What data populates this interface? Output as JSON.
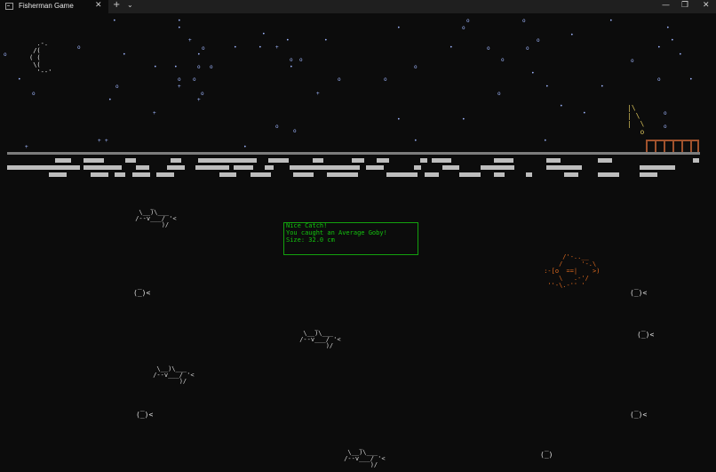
{
  "window": {
    "tab_title": "Fisherman Game",
    "tab_close": "✕",
    "new_tab": "+",
    "dropdown": "⌄",
    "minimize": "—",
    "maximize": "❐",
    "close": "✕"
  },
  "catch_dialog": {
    "heading": "Nice Catch!",
    "message": "You caught an Average Goby!",
    "size": "Size: 32.0 cm"
  },
  "colors": {
    "stars": "#9fb6ff",
    "dialog": "#13c40e",
    "caught_fish": "#e06b1f",
    "pier": "#a0522d"
  }
}
